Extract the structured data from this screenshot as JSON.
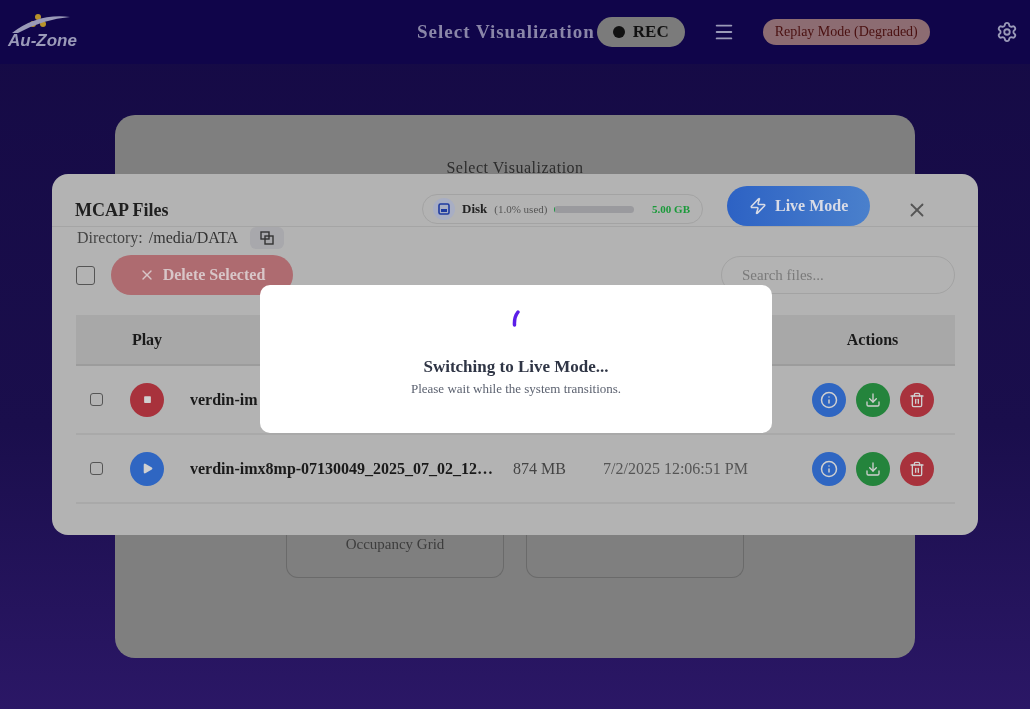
{
  "header": {
    "logo": "Au-Zone",
    "title": "Select Visualization",
    "rec": "REC",
    "mode_badge": "Replay Mode (Degraded)"
  },
  "background_panel": {
    "title": "Select Visualization",
    "cards": [
      {
        "kind": "labeled",
        "label": "Occupancy Grid"
      },
      {
        "kind": "blank"
      }
    ]
  },
  "mcap_dialog": {
    "title": "MCAP Files",
    "disk": {
      "label": "Disk",
      "usage": "(1.0% used)",
      "level": 0.01,
      "free": "5.00 GB"
    },
    "live_button": "Live Mode",
    "directory_label": "Directory:",
    "directory": "/media/DATA",
    "select_all_checked": false,
    "delete_button": "Delete Selected",
    "search": {
      "placeholder": "Search files..."
    },
    "columns": [
      "Play",
      "Actions"
    ],
    "rows": [
      {
        "checked": false,
        "playing": true,
        "name": "verdin-im"
      },
      {
        "checked": false,
        "playing": false,
        "name": "verdin-imx8mp-07130049_2025_07_02_12…",
        "size": "874 MB",
        "date": "7/2/2025 12:06:51 PM"
      }
    ]
  },
  "loading": {
    "title": "Switching to Live Mode...",
    "message": "Please wait while the system transitions."
  }
}
